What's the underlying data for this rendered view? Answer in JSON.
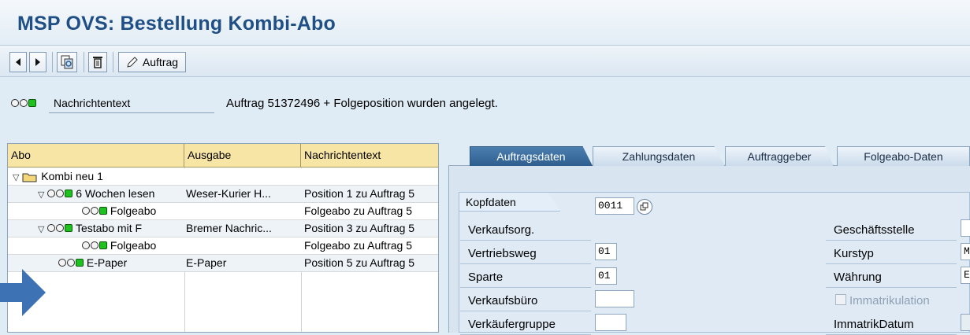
{
  "window": {
    "title": "MSP OVS: Bestellung Kombi-Abo"
  },
  "toolbar": {
    "order_label": "Auftrag"
  },
  "message": {
    "field_label": "Nachrichtentext",
    "text": "Auftrag 51372496 + Folgeposition wurden angelegt."
  },
  "tree": {
    "columns": [
      "Abo",
      "Ausgabe",
      "Nachrichtentext"
    ],
    "rows": [
      {
        "abo": "Kombi neu 1",
        "ausgabe": "",
        "text": ""
      },
      {
        "abo": "6 Wochen lesen",
        "ausgabe": "Weser-Kurier H...",
        "text": "Position 1 zu Auftrag 5"
      },
      {
        "abo": "Folgeabo",
        "ausgabe": "",
        "text": "Folgeabo zu Auftrag 5"
      },
      {
        "abo": "Testabo mit F",
        "ausgabe": "Bremer Nachric...",
        "text": "Position 3 zu Auftrag 5"
      },
      {
        "abo": "Folgeabo",
        "ausgabe": "",
        "text": "Folgeabo zu Auftrag 5"
      },
      {
        "abo": "E-Paper",
        "ausgabe": "E-Paper",
        "text": "Position 5 zu Auftrag 5"
      }
    ]
  },
  "tabs": [
    "Auftragsdaten",
    "Zahlungsdaten",
    "Auftraggeber",
    "Folgeabo-Daten"
  ],
  "active_tab": "Auftragsdaten",
  "kopfdaten": {
    "title": "Kopfdaten",
    "verkaufsorg_label": "Verkaufsorg.",
    "verkaufsorg_value": "0011",
    "vertriebsweg_label": "Vertriebsweg",
    "vertriebsweg_value": "01",
    "sparte_label": "Sparte",
    "sparte_value": "01",
    "verkaufsbuero_label": "Verkaufsbüro",
    "verkaeufergruppe_label": "Verkäufergruppe",
    "geschaeftsstelle_label": "Geschäftsstelle",
    "kurstyp_label": "Kurstyp",
    "kurstyp_value": "M",
    "waehrung_label": "Währung",
    "waehrung_value": "E",
    "immatrikulation_label": "Immatrikulation",
    "immatrikdatum_label": "ImmatrikDatum"
  },
  "colors": {
    "title": "#1f4f85",
    "tree_header": "#f7e5a6",
    "active_tab": "#2e5e8e",
    "status_green": "#1ec21e",
    "arrow": "#3d72b4"
  }
}
